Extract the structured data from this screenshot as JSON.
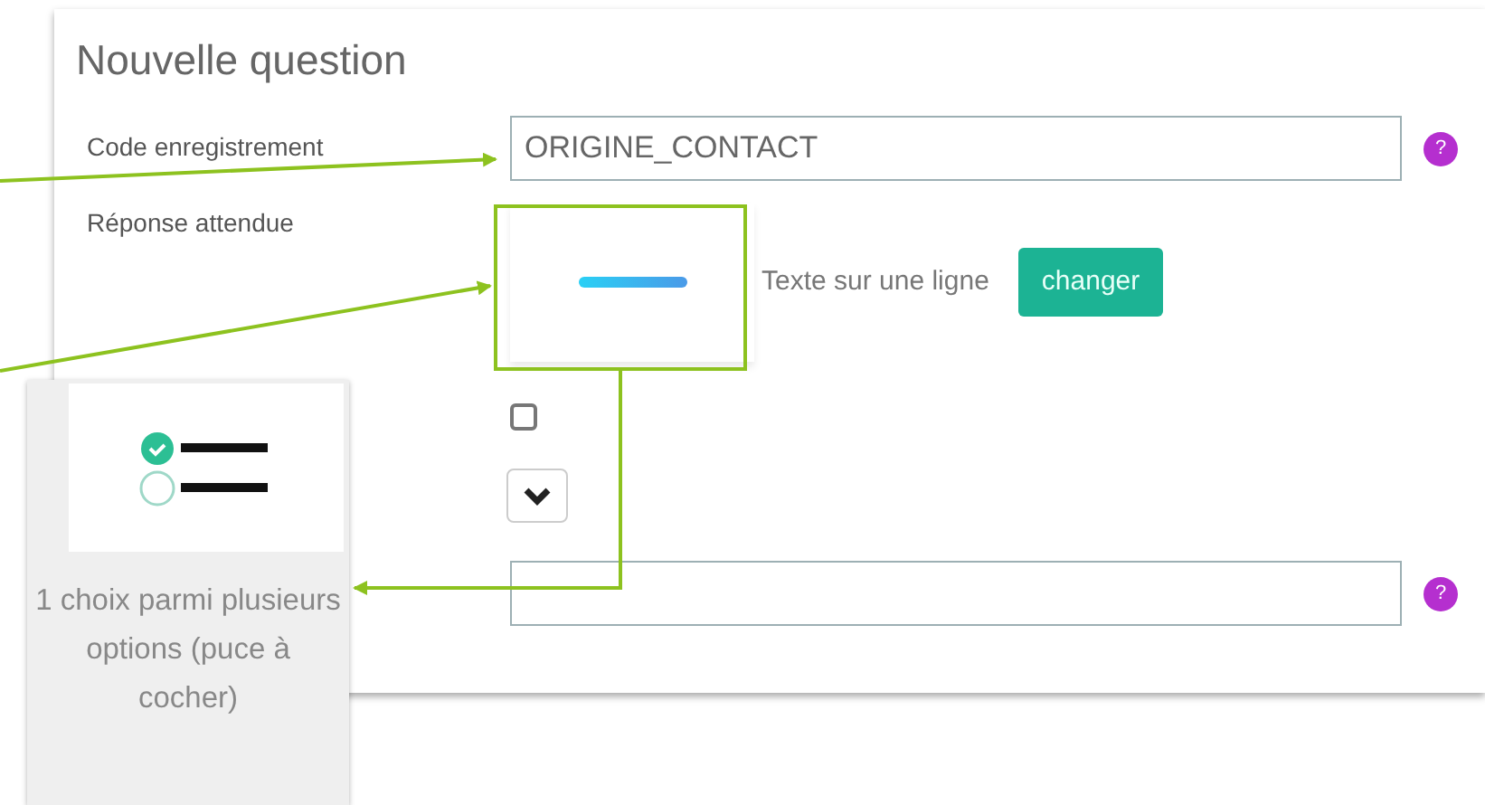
{
  "panel": {
    "title": "Nouvelle question"
  },
  "fields": [
    {
      "kind": "text",
      "label": "Code enregistrement",
      "value": "ORIGINE_CONTACT",
      "help": "?"
    },
    {
      "kind": "answer_type",
      "label": "Réponse attendue",
      "type_name": "Texte sur une ligne",
      "button": "changer"
    },
    {
      "kind": "checkbox",
      "checked": false
    },
    {
      "kind": "dropdown"
    },
    {
      "kind": "text",
      "help": "?"
    }
  ],
  "popup": {
    "caption": "1 choix parmi plusieurs options (puce à cocher)"
  }
}
